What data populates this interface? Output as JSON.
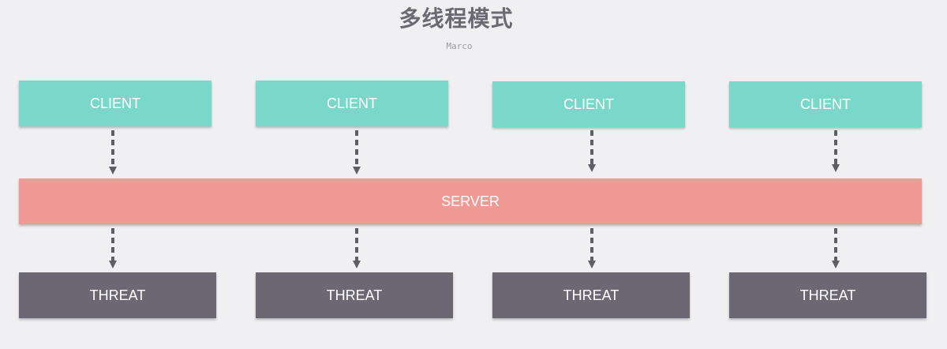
{
  "title": "多线程模式",
  "author": "Marco",
  "colors": {
    "background": "#f0f0f2",
    "client": "#7ad8cb",
    "server": "#f09a96",
    "threat": "#6b6874",
    "arrow": "#5f5e66"
  },
  "clients": [
    {
      "label": "CLIENT"
    },
    {
      "label": "CLIENT"
    },
    {
      "label": "CLIENT"
    },
    {
      "label": "CLIENT"
    }
  ],
  "server": {
    "label": "SERVER"
  },
  "threats": [
    {
      "label": "THREAT"
    },
    {
      "label": "THREAT"
    },
    {
      "label": "THREAT"
    },
    {
      "label": "THREAT"
    }
  ]
}
